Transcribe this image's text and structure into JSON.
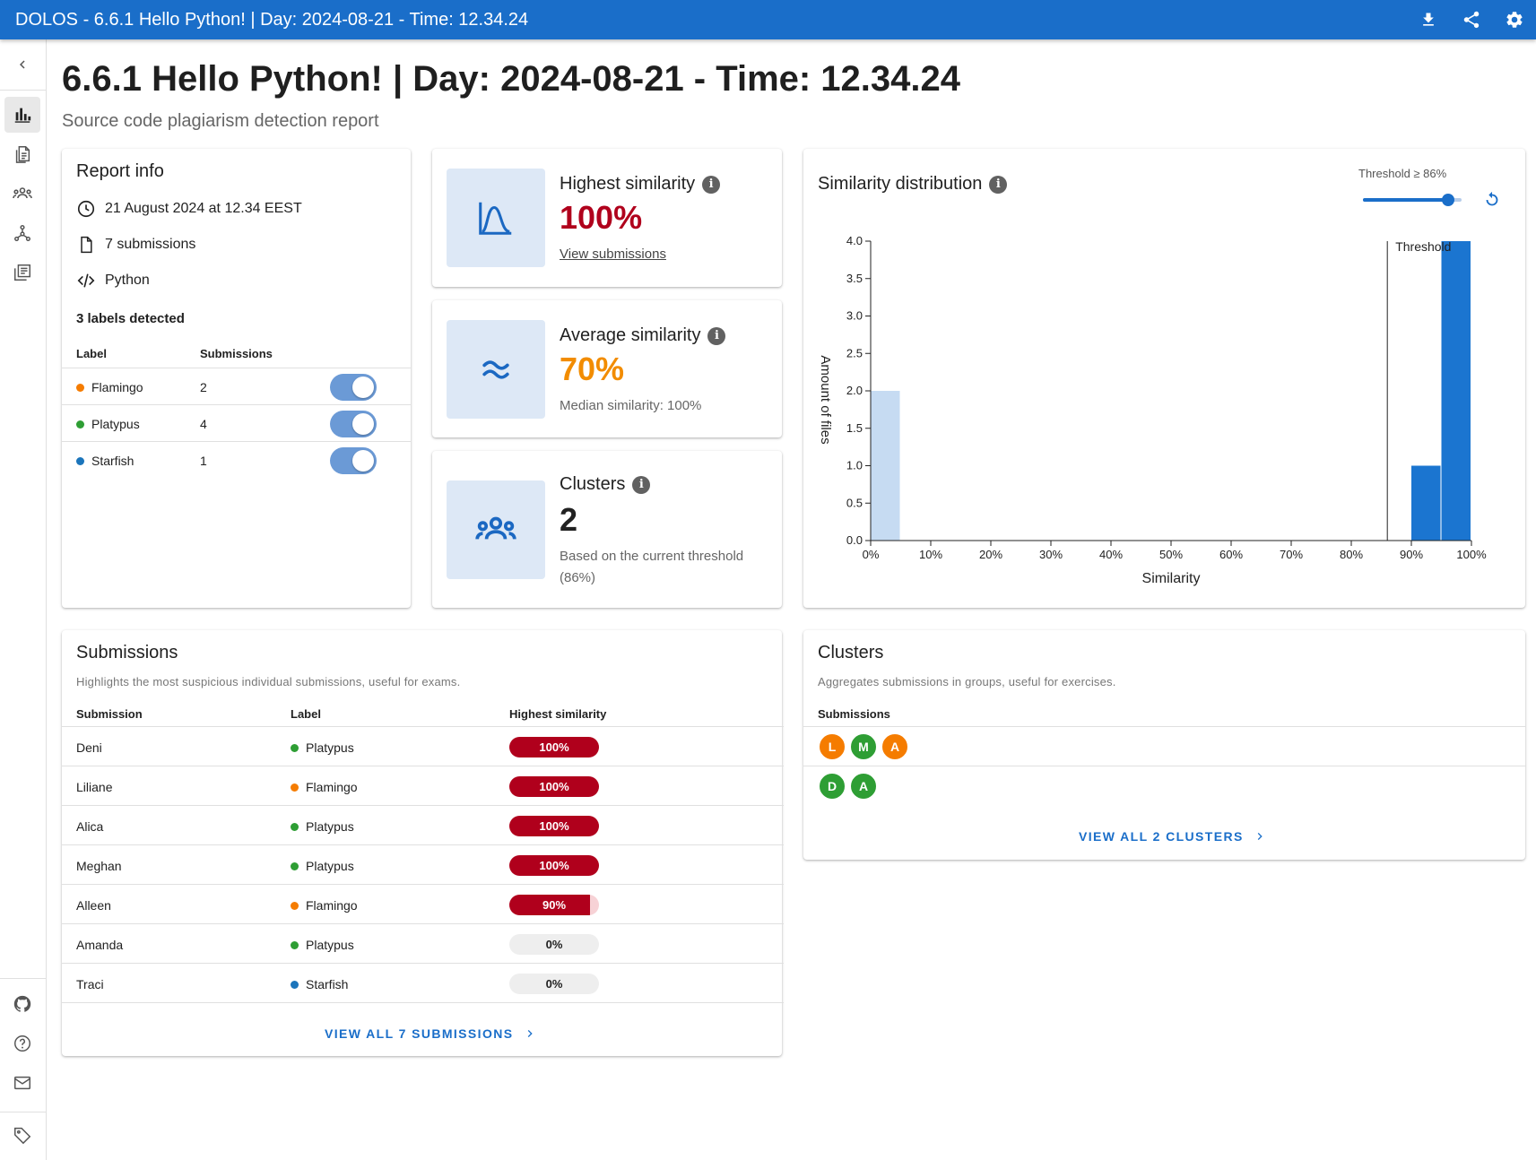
{
  "app_bar": {
    "title": "DOLOS - 6.6.1 Hello Python! | Day: 2024-08-21 - Time: 12.34.24",
    "actions": [
      "download-icon",
      "share-icon",
      "settings-icon"
    ]
  },
  "sidebar": {
    "collapse_icon": "chevron-left-icon",
    "items": [
      {
        "icon": "bar-chart-icon",
        "active": true
      },
      {
        "icon": "file-list-icon",
        "active": false
      },
      {
        "icon": "group-icon",
        "active": false
      },
      {
        "icon": "graph-icon",
        "active": false
      },
      {
        "icon": "library-icon",
        "active": false
      }
    ],
    "footer_items": [
      "github-icon",
      "help-icon",
      "mail-icon"
    ],
    "version_icon": "tag-icon"
  },
  "page": {
    "title": "6.6.1 Hello Python! | Day: 2024-08-21 - Time: 12.34.24",
    "subtitle": "Source code plagiarism detection report"
  },
  "report_info": {
    "title": "Report info",
    "date": "21 August 2024 at 12.34 EEST",
    "submissions": "7 submissions",
    "language": "Python",
    "labels_heading": "3 labels detected",
    "columns": {
      "label": "Label",
      "submissions": "Submissions"
    },
    "labels": [
      {
        "name": "Flamingo",
        "count": "2",
        "color": "#f57c00",
        "enabled": true
      },
      {
        "name": "Platypus",
        "count": "4",
        "color": "#2e9e34",
        "enabled": true
      },
      {
        "name": "Starfish",
        "count": "1",
        "color": "#1b75bb",
        "enabled": true
      }
    ]
  },
  "highest_similarity": {
    "title": "Highest similarity",
    "value": "100%",
    "link": "View submissions",
    "color": "#b0001c"
  },
  "average_similarity": {
    "title": "Average similarity",
    "value": "70%",
    "median": "Median similarity: 100%",
    "color": "#f28c00"
  },
  "clusters_stat": {
    "title": "Clusters",
    "value": "2",
    "note": "Based on the current threshold (86%)"
  },
  "distribution": {
    "title": "Similarity distribution",
    "threshold_label": "Threshold ≥ 86%",
    "threshold_value": 0.86
  },
  "chart_data": {
    "type": "bar",
    "title": "Similarity distribution",
    "xlabel": "Similarity",
    "ylabel": "Amount of files",
    "x_ticks": [
      "0%",
      "10%",
      "20%",
      "30%",
      "40%",
      "50%",
      "60%",
      "70%",
      "80%",
      "90%",
      "100%"
    ],
    "y_ticks": [
      "0.0",
      "0.5",
      "1.0",
      "1.5",
      "2.0",
      "2.5",
      "3.0",
      "3.5",
      "4.0"
    ],
    "xlim": [
      0,
      1
    ],
    "ylim": [
      0,
      4
    ],
    "bin_width": 0.05,
    "bins": [
      {
        "start": 0.0,
        "count": 2
      },
      {
        "start": 0.9,
        "count": 1
      },
      {
        "start": 0.95,
        "count": 4
      }
    ],
    "threshold": 0.86,
    "threshold_label": "Threshold",
    "colors": {
      "below": "#c6dbf2",
      "above": "#1b75d0"
    }
  },
  "submissions": {
    "title": "Submissions",
    "description": "Highlights the most suspicious individual submissions, useful for exams.",
    "columns": {
      "submission": "Submission",
      "label": "Label",
      "similarity": "Highest similarity"
    },
    "rows": [
      {
        "name": "Deni",
        "label": "Platypus",
        "label_color": "#2e9e34",
        "similarity": "100%",
        "value": 1.0
      },
      {
        "name": "Liliane",
        "label": "Flamingo",
        "label_color": "#f57c00",
        "similarity": "100%",
        "value": 1.0
      },
      {
        "name": "Alica",
        "label": "Platypus",
        "label_color": "#2e9e34",
        "similarity": "100%",
        "value": 1.0
      },
      {
        "name": "Meghan",
        "label": "Platypus",
        "label_color": "#2e9e34",
        "similarity": "100%",
        "value": 1.0
      },
      {
        "name": "Alleen",
        "label": "Flamingo",
        "label_color": "#f57c00",
        "similarity": "90%",
        "value": 0.9
      },
      {
        "name": "Amanda",
        "label": "Platypus",
        "label_color": "#2e9e34",
        "similarity": "0%",
        "value": 0.0
      },
      {
        "name": "Traci",
        "label": "Starfish",
        "label_color": "#1b75bb",
        "similarity": "0%",
        "value": 0.0
      }
    ],
    "view_all": "VIEW ALL 7 SUBMISSIONS"
  },
  "clusters": {
    "title": "Clusters",
    "description": "Aggregates submissions in groups, useful for exercises.",
    "column": "Submissions",
    "groups": [
      [
        {
          "initial": "L",
          "color": "#f57c00"
        },
        {
          "initial": "M",
          "color": "#2e9e34"
        },
        {
          "initial": "A",
          "color": "#f57c00"
        }
      ],
      [
        {
          "initial": "D",
          "color": "#2e9e34"
        },
        {
          "initial": "A",
          "color": "#2e9e34"
        }
      ]
    ],
    "view_all": "VIEW ALL 2 CLUSTERS"
  }
}
